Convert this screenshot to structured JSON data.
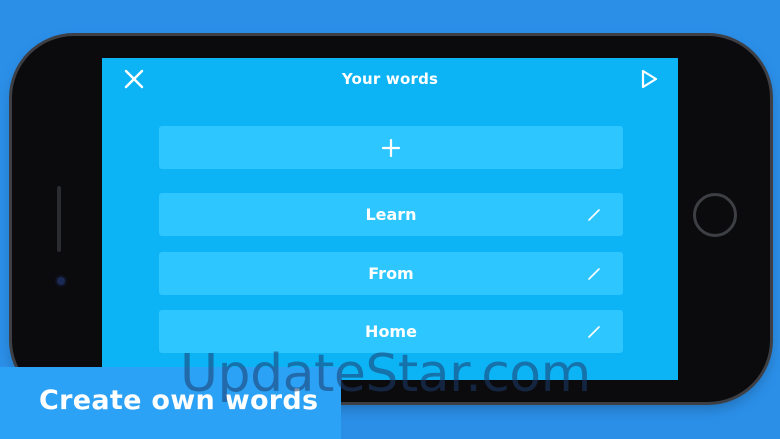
{
  "screen": {
    "title": "Your words",
    "close_icon": "close-icon",
    "play_icon": "play-icon",
    "add_icon": "plus-icon",
    "add_button_label": "+"
  },
  "word_lists": [
    {
      "label": "Learn",
      "edit_icon": "pencil-icon"
    },
    {
      "label": "From",
      "edit_icon": "pencil-icon"
    },
    {
      "label": "Home",
      "edit_icon": "pencil-icon"
    }
  ],
  "banner": {
    "text": "Create own words"
  },
  "watermark": {
    "text": "UpdateStar.com"
  },
  "colors": {
    "background": "#2b8fe8",
    "screen": "#0cb4f6",
    "card": "#2ec6ff",
    "banner": "#2ba2f5",
    "phone_body": "#0b0b0d"
  }
}
